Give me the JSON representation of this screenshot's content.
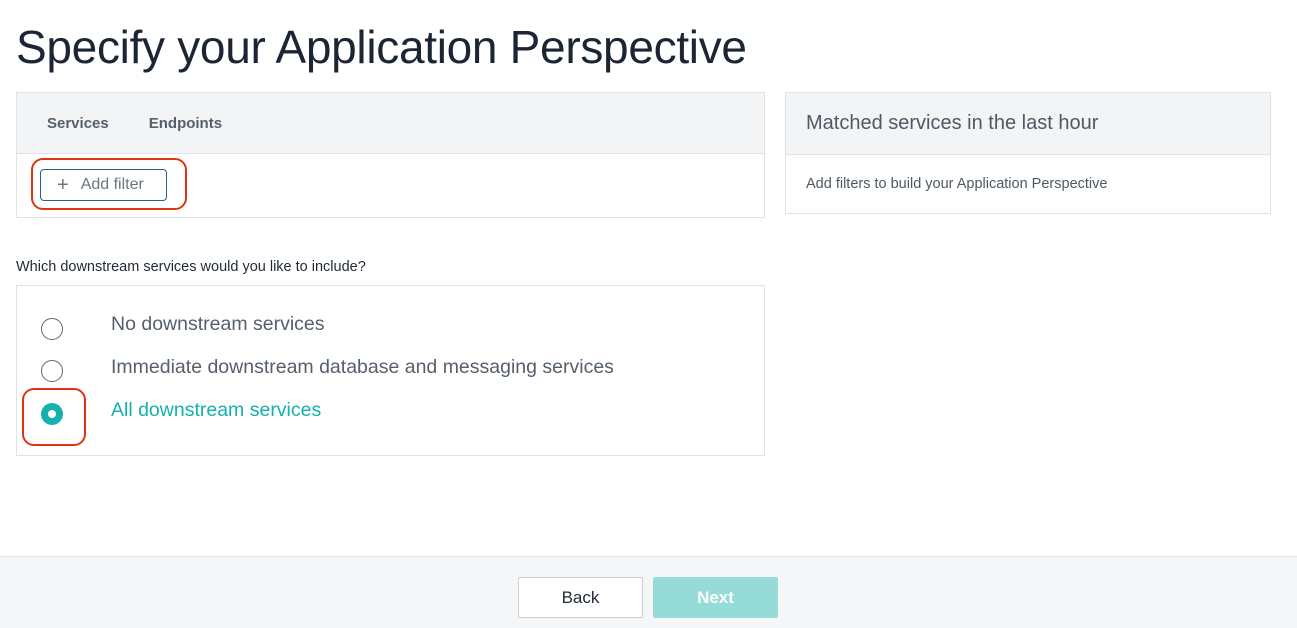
{
  "page": {
    "title": "Specify your Application Perspective"
  },
  "filter_panel": {
    "tabs": [
      "Services",
      "Endpoints"
    ],
    "add_filter_label": "Add filter",
    "add_filter_icon": "plus-icon"
  },
  "matched_panel": {
    "title": "Matched services in the last hour",
    "message": "Add filters to build your Application Perspective"
  },
  "downstream": {
    "question": "Which downstream services would you like to include?",
    "options": [
      {
        "label": "No downstream services",
        "selected": false
      },
      {
        "label": "Immediate downstream database and messaging services",
        "selected": false
      },
      {
        "label": "All downstream services",
        "selected": true
      }
    ]
  },
  "footer": {
    "back_label": "Back",
    "next_label": "Next"
  },
  "colors": {
    "accent": "#14b1ad",
    "next_button_disabled": "#95dcd9",
    "highlight": "#e0330f",
    "filter_button_border": "#2b5d93"
  }
}
